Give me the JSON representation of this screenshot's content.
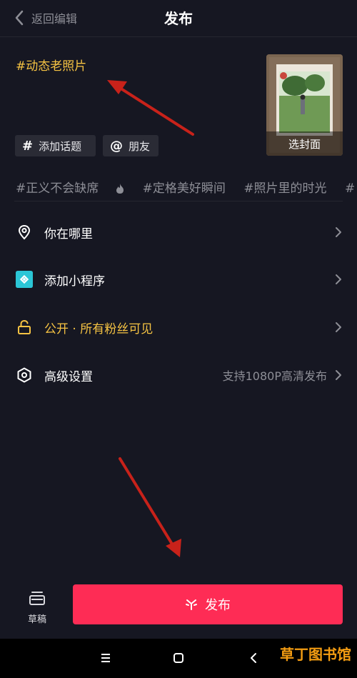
{
  "header": {
    "back_label": "返回编辑",
    "title": "发布"
  },
  "caption": {
    "text": "#动态老照片"
  },
  "cover": {
    "label": "选封面"
  },
  "chips": [
    {
      "symbol": "#",
      "label": "添加话题"
    },
    {
      "symbol": "@",
      "label": "朋友"
    }
  ],
  "suggested_topics": [
    "#正义不会缺席",
    "#定格美好瞬间",
    "#照片里的时光",
    "#"
  ],
  "rows": {
    "location": {
      "label": "你在哪里"
    },
    "mini_program": {
      "label": "添加小程序"
    },
    "visibility": {
      "label": "公开 · 所有粉丝可见"
    },
    "advanced": {
      "label": "高级设置",
      "value": "支持1080P高清发布"
    }
  },
  "bottom": {
    "draft_label": "草稿",
    "publish_label": "发布"
  },
  "watermark": "草丁图书馆",
  "colors": {
    "accent": "#fe2c55",
    "caption_yellow": "#f6c343",
    "background": "#161722",
    "teal": "#2bc6d6"
  }
}
